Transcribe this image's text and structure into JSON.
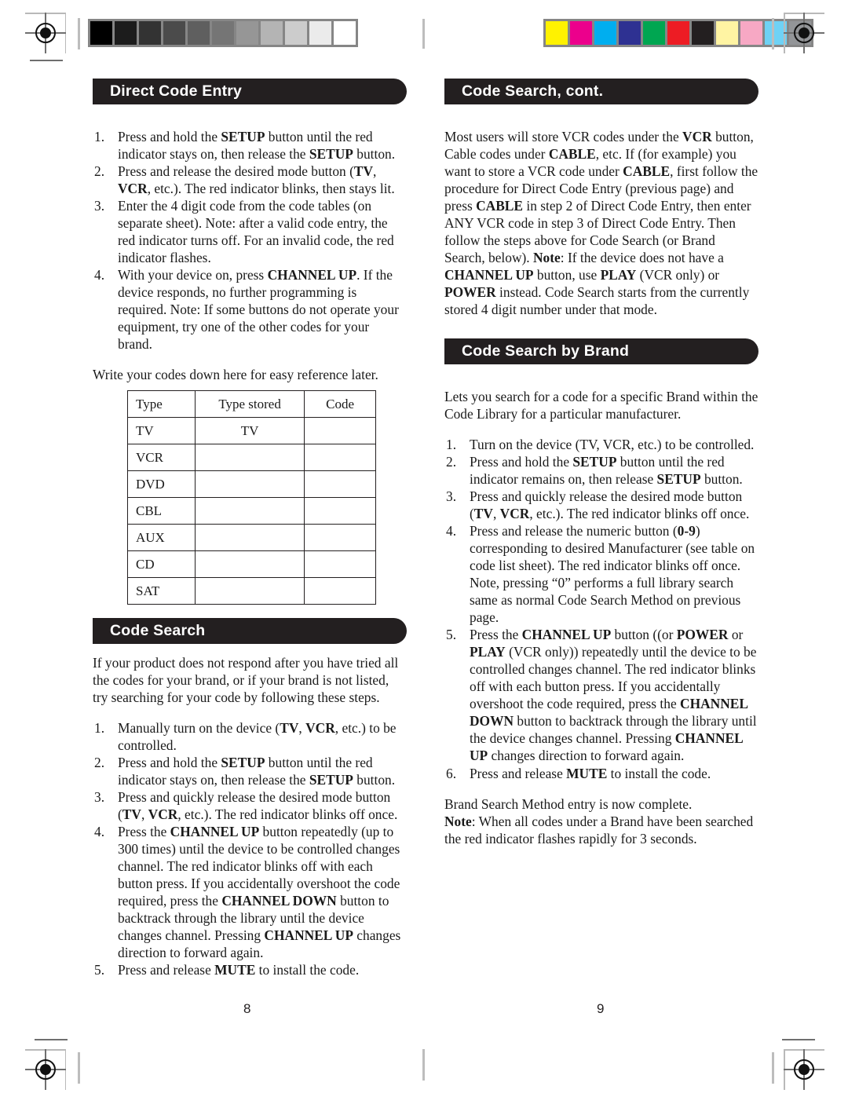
{
  "printer_marks": {
    "grayscale_ramp": [
      "#000000",
      "#1c1c1c",
      "#333333",
      "#4b4b4b",
      "#5f5f5f",
      "#757575",
      "#969696",
      "#b4b4b4",
      "#cccccc",
      "#ebebeb",
      "#ffffff"
    ],
    "color_bar": [
      "#fff200",
      "#ec008c",
      "#00aeef",
      "#2e3192",
      "#00a651",
      "#ed1c24",
      "#231f20",
      "#fff4a3",
      "#f7a8c4",
      "#6fd2f5",
      "#939598"
    ],
    "registration_icon": "registration-target-icon"
  },
  "left_page": {
    "page_number": "8",
    "sections": [
      {
        "id": "direct-code-entry",
        "title": "Direct Code Entry",
        "steps": [
          {
            "num": "1.",
            "html": "Press and hold the <b>SETUP</b> button until the red indicator stays on, then release the <b>SETUP</b> button."
          },
          {
            "num": "2.",
            "html": "Press and release the desired mode button (<b>TV</b>, <b>VCR</b>, etc.). The red indicator blinks, then stays lit."
          },
          {
            "num": "3.",
            "html": "Enter the 4 digit code from the code tables (on separate sheet). Note: after a valid code entry, the red indicator turns off.  For an invalid code, the red indicator flashes."
          },
          {
            "num": "4.",
            "html": "With your device on, press <b>CHANNEL UP</b>. If the device responds, no further programming is required. Note: If some buttons do not operate your equipment, try one of the other codes for your brand."
          }
        ],
        "note_text": "Write your codes down here for easy reference later.",
        "table": {
          "headers": [
            "Type",
            "Type stored",
            "Code"
          ],
          "rows": [
            {
              "type": "TV",
              "stored": "TV",
              "code": ""
            },
            {
              "type": "VCR",
              "stored": "",
              "code": ""
            },
            {
              "type": "DVD",
              "stored": "",
              "code": ""
            },
            {
              "type": "CBL",
              "stored": "",
              "code": ""
            },
            {
              "type": "AUX",
              "stored": "",
              "code": ""
            },
            {
              "type": "CD",
              "stored": "",
              "code": ""
            },
            {
              "type": "SAT",
              "stored": "",
              "code": ""
            }
          ]
        }
      },
      {
        "id": "code-search",
        "title": "Code Search",
        "intro": "If your product does not respond after you have tried all the codes for your brand, or if your brand is not listed, try searching for your code by following these steps.",
        "steps": [
          {
            "num": "1.",
            "html": "Manually turn on the device (<b>TV</b>, <b>VCR</b>, etc.) to be controlled."
          },
          {
            "num": "2.",
            "html": "Press and hold the <b>SETUP</b> button until the red indicator stays on, then release the <b>SETUP</b> button."
          },
          {
            "num": "3.",
            "html": "Press and quickly release the desired mode button (<b>TV</b>, <b>VCR</b>, etc.). The red indicator blinks off once."
          },
          {
            "num": "4.",
            "html": "Press the <b>CHANNEL UP</b> button repeatedly (up to 300 times) until the device to be controlled changes channel. The red indicator blinks off with each button press.  If you accidentally overshoot the code required, press the <b>CHANNEL DOWN</b> button to backtrack through the library until the device changes channel. Pressing <b>CHANNEL UP</b> changes direction to forward again."
          },
          {
            "num": "5.",
            "html": "Press and release <b>MUTE</b> to install the code."
          }
        ]
      }
    ]
  },
  "right_page": {
    "page_number": "9",
    "sections": [
      {
        "id": "code-search-cont",
        "title": "Code Search, cont.",
        "body_html": "Most users will store VCR codes under the <b>VCR</b> button, Cable codes under <b>CABLE</b>, etc. If (for example) you want to store a VCR code under <b>CABLE</b>, first follow the procedure for Direct Code Entry (previous page) and press <b>CABLE</b> in step 2 of Direct Code Entry, then enter ANY VCR code in step 3 of Direct Code Entry. Then follow the steps above for Code Search (or Brand Search, below). <b>Note</b>:  If the device does not have a <b>CHANNEL UP</b> button, use <b>PLAY</b> (VCR only) or <b>POWER</b> instead. Code Search starts from the currently stored 4 digit number under that mode."
      },
      {
        "id": "code-search-by-brand",
        "title": "Code Search by Brand",
        "intro": "Lets you search for a code for a specific Brand within the Code Library for a particular manufacturer.",
        "steps": [
          {
            "num": "1.",
            "html": "Turn on the device (TV, VCR, etc.) to be controlled."
          },
          {
            "num": "2.",
            "html": "Press and hold the <b>SETUP</b> button until the red indicator remains on, then release <b>SETUP</b> button."
          },
          {
            "num": "3.",
            "html": "Press and quickly release the desired mode button (<b>TV</b>, <b>VCR</b>, etc.). The red indicator blinks off once."
          },
          {
            "num": "4.",
            "html": "Press and release the numeric button (<b>0-9</b>) corresponding to desired Manufacturer (see table on code list sheet).  The red indicator blinks off once. Note, pressing &ldquo;0&rdquo; performs a full library search same as normal Code Search Method on previous page."
          },
          {
            "num": "5.",
            "html": "Press the <b>CHANNEL UP</b> button ((or <b>POWER</b> or <b>PLAY</b> (VCR only)) repeatedly until the device to be controlled changes channel. The red indicator blinks off with each button press. If you accidentally overshoot the code required, press the <b>CHANNEL DOWN</b> button to backtrack through the library until the device changes channel. Pressing <b>CHANNEL UP</b> changes direction to forward again."
          },
          {
            "num": "6.",
            "html": "Press and release <b>MUTE</b> to install the code."
          }
        ],
        "closing_html": "Brand Search Method entry is now complete.<br><b>Note</b>: When all codes under a Brand have been searched the red indicator flashes rapidly for 3 seconds."
      }
    ]
  }
}
